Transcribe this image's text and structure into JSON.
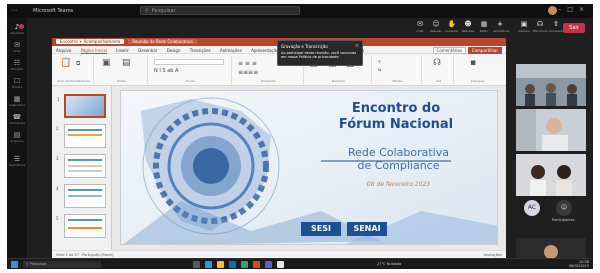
{
  "titlebar": {
    "app": "Microsoft Teams",
    "search_placeholder": "Pesquisar"
  },
  "rail": [
    {
      "label": "Atividade",
      "glyph": "♪"
    },
    {
      "label": "Chat",
      "glyph": "✉"
    },
    {
      "label": "Equipes",
      "glyph": "☷"
    },
    {
      "label": "Tarefas",
      "glyph": "☐"
    },
    {
      "label": "Calendário",
      "glyph": "▦"
    },
    {
      "label": "Chamadas",
      "glyph": "☎"
    },
    {
      "label": "Arquivos",
      "glyph": "▤"
    },
    {
      "label": "Aplicativos",
      "glyph": "☰"
    }
  ],
  "meeting": {
    "buttons": [
      "Chat",
      "Pessoas",
      "Levantar",
      "Reações",
      "Exibir",
      "Aplicativos"
    ],
    "media": [
      "Câmera",
      "Microfone",
      "Compartilhar"
    ],
    "leave": "Sair"
  },
  "ppt": {
    "tabs": [
      "Encontro + Acompanhamento",
      "Reunião de Rede Colaborativa"
    ],
    "menu": [
      "Arquivo",
      "Página Inicial",
      "Inserir",
      "Desenhar",
      "Design",
      "Transições",
      "Animações",
      "Apresentação de Slides",
      "Revisão",
      "Exibir",
      "Ajuda"
    ],
    "menu_active": 1,
    "share_btn": "Compartilhar",
    "comments_btn": "Comentários",
    "groups": [
      "Área de Transferência",
      "Slides",
      "Fonte",
      "Parágrafo",
      "Desenho",
      "Edição",
      "Voz",
      "Designer"
    ],
    "status_left": "Slide 1 de 27",
    "status_lang": "Português (Brasil)",
    "status_right": "Anotações"
  },
  "popup": {
    "title": "Gravação e Transcrição",
    "body": "Ao participar desta reunião, você concorda em nossa Política de privacidade"
  },
  "slide": {
    "title1": "Encontro do",
    "title2": "Fórum Nacional",
    "subtitle1": "Rede Colaborativa",
    "subtitle2": "de Compliance",
    "date": "08 de fevereiro 2023",
    "logo1": "SESI",
    "logo2": "SENAI"
  },
  "participants": {
    "initials": "AC",
    "count_label": "Participantes"
  },
  "taskbar": {
    "task": "Pesquisar",
    "weather": "27°C Nublado",
    "time": "10:58",
    "date": "08/02/2023"
  },
  "colors": {
    "accent": "#b7472a",
    "teams_bg": "#1f1f1f",
    "leave": "#c4314b",
    "slide_blue": "#1d4f91"
  }
}
